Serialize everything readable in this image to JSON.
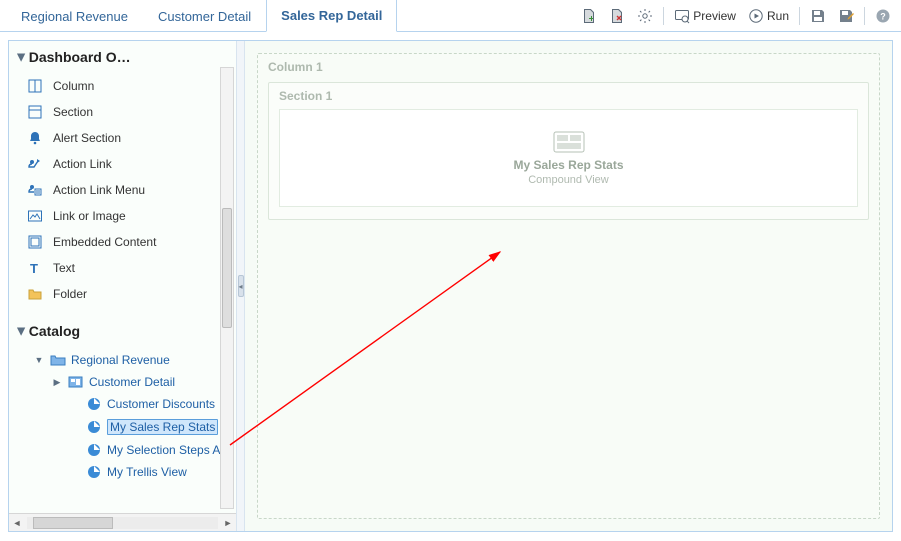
{
  "tabs": [
    {
      "label": "Regional Revenue",
      "active": false
    },
    {
      "label": "Customer Detail",
      "active": false
    },
    {
      "label": "Sales Rep Detail",
      "active": true
    }
  ],
  "toolbar": {
    "doc_add": "Add",
    "doc_remove": "Delete",
    "gear": "Properties",
    "preview_label": "Preview",
    "run_label": "Run",
    "save": "Save",
    "save_as": "Save As",
    "help": "Help"
  },
  "panels": {
    "objects_title": "Dashboard O…",
    "catalog_title": "Catalog"
  },
  "objects": [
    {
      "icon": "column",
      "label": "Column"
    },
    {
      "icon": "section",
      "label": "Section"
    },
    {
      "icon": "alert",
      "label": "Alert Section"
    },
    {
      "icon": "action",
      "label": "Action Link"
    },
    {
      "icon": "actionmenu",
      "label": "Action Link Menu"
    },
    {
      "icon": "link",
      "label": "Link or Image"
    },
    {
      "icon": "embed",
      "label": "Embedded Content"
    },
    {
      "icon": "text",
      "label": "Text"
    },
    {
      "icon": "folder",
      "label": "Folder"
    }
  ],
  "catalog": {
    "root": {
      "label": "Regional Revenue",
      "expanded": true
    },
    "children": [
      {
        "type": "folder",
        "label": "Customer Detail",
        "expanded": false,
        "has_children": true
      },
      {
        "type": "analysis",
        "label": "Customer Discounts"
      },
      {
        "type": "analysis",
        "label": "My Sales Rep Stats",
        "selected": true
      },
      {
        "type": "analysis",
        "label": "My Selection Steps A"
      },
      {
        "type": "analysis",
        "label": "My Trellis View"
      }
    ]
  },
  "canvas": {
    "column_label": "Column 1",
    "section_label": "Section 1",
    "tile": {
      "title": "My Sales Rep Stats",
      "subtitle": "Compound View"
    }
  }
}
